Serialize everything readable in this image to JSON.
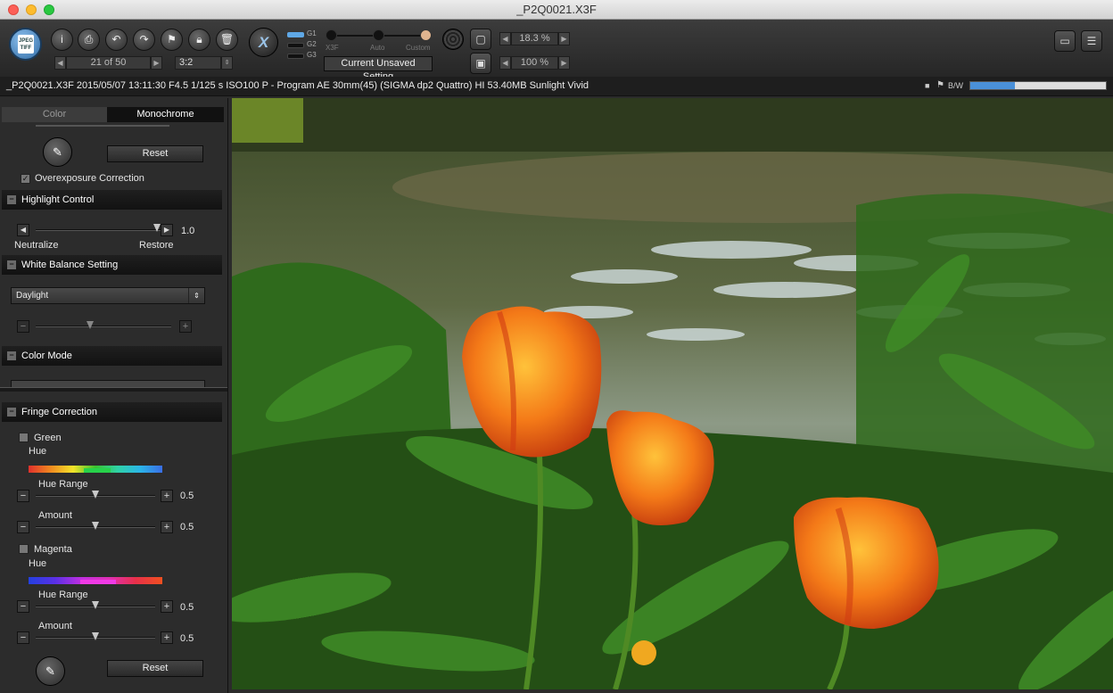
{
  "window": {
    "title": "_P2Q0021.X3F"
  },
  "toolbar": {
    "jpeg_tiff_label": "JPEG TIFF",
    "nav_counter": "21 of 50",
    "aspect_ratio": "3:2",
    "g_labels": [
      "G1",
      "G2",
      "G3"
    ],
    "wb_slider_labels": [
      "X3F",
      "Auto",
      "Custom"
    ],
    "setting_button": "Current Unsaved Setting",
    "zoom_top": "18.3 %",
    "zoom_bottom": "100 %"
  },
  "info": {
    "text": "_P2Q0021.X3F 2015/05/07 13:11:30 F4.5 1/125 s ISO100 P - Program AE 30mm(45) (SIGMA dp2 Quattro) HI 53.40MB Sunlight Vivid",
    "bw_label": "B/W",
    "progress": 0.33
  },
  "panel": {
    "tabs": [
      "Color",
      "Monochrome"
    ],
    "active_tab": "Monochrome",
    "reset_label": "Reset",
    "overexposure_label": "Overexposure Correction",
    "highlight": {
      "title": "Highlight Control",
      "value": "1.0",
      "left_label": "Neutralize",
      "right_label": "Restore",
      "level": 0.97
    },
    "white_balance": {
      "title": "White Balance Setting",
      "selected": "Daylight",
      "level": 0.4
    },
    "color_mode": {
      "title": "Color Mode"
    },
    "fringe": {
      "title": "Fringe Correction",
      "green": {
        "label": "Green",
        "hue_label": "Hue",
        "hue_range_label": "Hue Range",
        "hue_range_value": "0.5",
        "amount_label": "Amount",
        "amount_value": "0.5"
      },
      "magenta": {
        "label": "Magenta",
        "hue_label": "Hue",
        "hue_range_label": "Hue Range",
        "hue_range_value": "0.5",
        "amount_label": "Amount",
        "amount_value": "0.5"
      },
      "reset_label": "Reset"
    }
  },
  "colors": {
    "accent": "#5fa8e6",
    "toolbar_bg": "#2f2f2f",
    "panel_bg": "#2c2c2c"
  }
}
